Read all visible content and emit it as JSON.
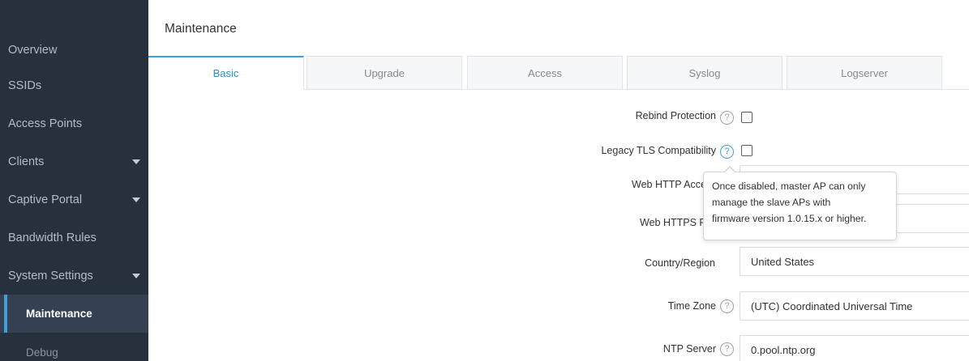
{
  "sidebar": {
    "items": [
      {
        "label": "Overview"
      },
      {
        "label": "SSIDs"
      },
      {
        "label": "Access Points"
      },
      {
        "label": "Clients"
      },
      {
        "label": "Captive Portal"
      },
      {
        "label": "Bandwidth Rules"
      },
      {
        "label": "System Settings"
      },
      {
        "label": "Maintenance"
      },
      {
        "label": "Debug"
      }
    ]
  },
  "header": {
    "title": "Maintenance"
  },
  "tabs": [
    {
      "label": "Basic"
    },
    {
      "label": "Upgrade"
    },
    {
      "label": "Access"
    },
    {
      "label": "Syslog"
    },
    {
      "label": "Logserver"
    }
  ],
  "form": {
    "rebind_protection_label": "Rebind Protection",
    "legacy_tls_label": "Legacy TLS Compatibility",
    "web_http_label": "Web HTTP Acce",
    "web_https_label": "Web HTTPS P",
    "country_label": "Country/Region",
    "country_value": "United States",
    "timezone_label": "Time Zone",
    "timezone_value": "(UTC) Coordinated Universal Time",
    "ntp_label": "NTP Server",
    "ntp_value": "0.pool.ntp.org"
  },
  "tooltip": {
    "line1": "Once disabled, master AP can only",
    "line2": "manage the slave APs with",
    "line3": "firmware version 1.0.15.x or higher."
  },
  "icons": {
    "help": "?"
  },
  "colors": {
    "sidebar_bg": "#27303d",
    "accent": "#3fa0d8",
    "active_item_bg": "#354153"
  }
}
